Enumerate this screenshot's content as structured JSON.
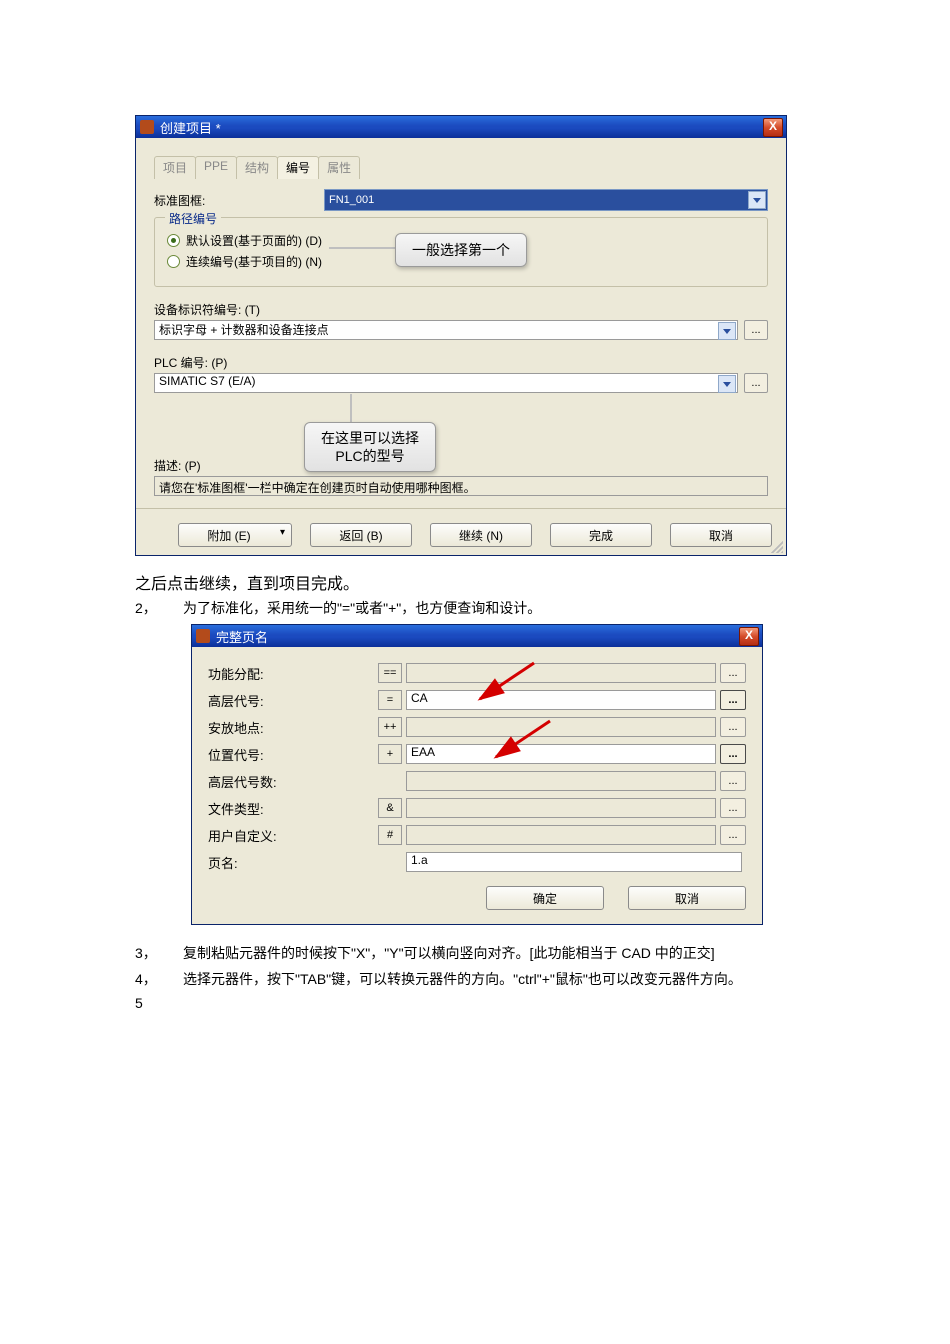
{
  "dialog1": {
    "title": "创建项目 *",
    "close": "X",
    "tabs": [
      "项目",
      "PPE",
      "结构",
      "编号",
      "属性"
    ],
    "active_tab": "编号",
    "std_frame_label": "标准图框:",
    "std_frame_value": "FN1_001",
    "group_legend": "路径编号",
    "radio_default": "默认设置(基于页面的) (D)",
    "radio_seq": "连续编号(基于项目的) (N)",
    "callout1": "一般选择第一个",
    "device_id_label": "设备标识符编号: (T)",
    "device_id_value": "标识字母 + 计数器和设备连接点",
    "plc_label": "PLC 编号: (P)",
    "plc_value": "SIMATIC S7 (E/A)",
    "callout2_line1": "在这里可以选择",
    "callout2_line2": "PLC的型号",
    "desc_label": "描述: (P)",
    "desc_value": "请您在'标准图框'一栏中确定在创建页时自动使用哪种图框。",
    "btn_add": "附加 (E)",
    "btn_back": "返回 (B)",
    "btn_next": "继续 (N)",
    "btn_finish": "完成",
    "btn_cancel": "取消"
  },
  "body": {
    "line1": "之后点击继续，直到项目完成。",
    "item2_n": "2，",
    "item2_t": "为了标准化，采用统一的\"=\"或者\"+\"，也方便查询和设计。",
    "item3_n": "3，",
    "item3_t": "复制粘贴元器件的时候按下\"X\"，\"Y\"可以横向竖向对齐。[此功能相当于 CAD 中的正交]",
    "item4_n": "4，",
    "item4_t": "选择元器件，按下\"TAB\"键，可以转换元器件的方向。\"ctrl\"+\"鼠标\"也可以改变元器件方向。",
    "item5_n": "5"
  },
  "dialog2": {
    "title": "完整页名",
    "close": "X",
    "rows": [
      {
        "label": "功能分配:",
        "prefix": "==",
        "value": "",
        "grey": true,
        "bold": false
      },
      {
        "label": "高层代号:",
        "prefix": "=",
        "value": "CA",
        "grey": false,
        "bold": true
      },
      {
        "label": "安放地点:",
        "prefix": "++",
        "value": "",
        "grey": true,
        "bold": false
      },
      {
        "label": "位置代号:",
        "prefix": "+",
        "value": "EAA",
        "grey": false,
        "bold": true
      },
      {
        "label": "高层代号数:",
        "prefix": "",
        "value": "",
        "grey": true,
        "bold": false
      },
      {
        "label": "文件类型:",
        "prefix": "&",
        "value": "",
        "grey": true,
        "bold": false
      },
      {
        "label": "用户自定义:",
        "prefix": "#",
        "value": "",
        "grey": true,
        "bold": false
      },
      {
        "label": "页名:",
        "prefix": "",
        "value": "1.a",
        "grey": false,
        "bold": false,
        "noElips": true
      }
    ],
    "btn_ok": "确定",
    "btn_cancel": "取消"
  }
}
